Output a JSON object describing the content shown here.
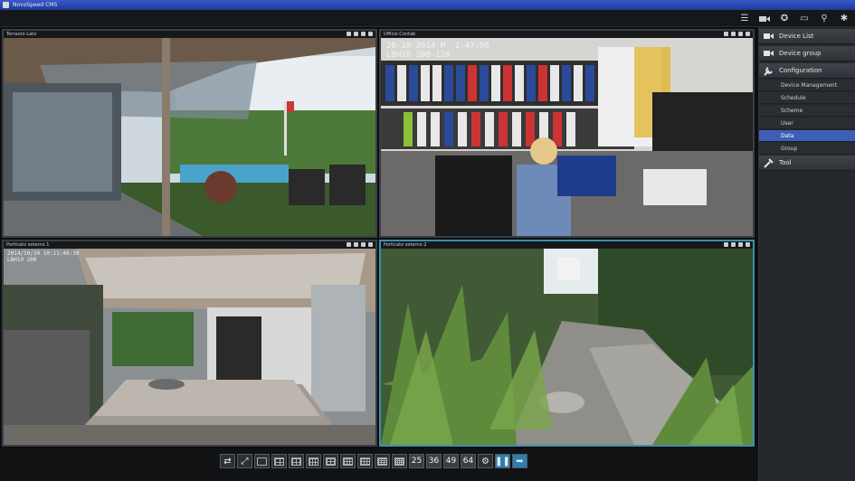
{
  "window": {
    "title": "NovoSpeed CMS"
  },
  "toolbar": {
    "icons": [
      "list-icon",
      "camera-icon",
      "settings-icon",
      "monitor-icon",
      "pin-icon",
      "bell-icon"
    ]
  },
  "tiles": [
    {
      "name": "Terrazzo Lato",
      "osd": ""
    },
    {
      "name": "Ufficio Contab",
      "osd": "20-10-2014 M  2:47:06\nLBH10 200-128"
    },
    {
      "name": "Porticato esterno 1",
      "osd": "2014/10/20 10:11:40:39\nLBH10 200"
    },
    {
      "name": "Porticato esterno 2",
      "osd": ""
    }
  ],
  "sidebar": {
    "items": [
      {
        "label": "Device List",
        "icon": "video-camera-icon"
      },
      {
        "label": "Device group",
        "icon": "video-camera-icon"
      },
      {
        "label": "Configuration",
        "icon": "wrench-icon"
      },
      {
        "label": "Tool",
        "icon": "tool-icon"
      }
    ],
    "config_sub": [
      "Device Management",
      "Schedule",
      "Scheme",
      "User",
      "Data",
      "Group"
    ],
    "selected_sub": "Data"
  },
  "bottom": {
    "layouts": [
      "25",
      "36",
      "49",
      "64"
    ]
  }
}
